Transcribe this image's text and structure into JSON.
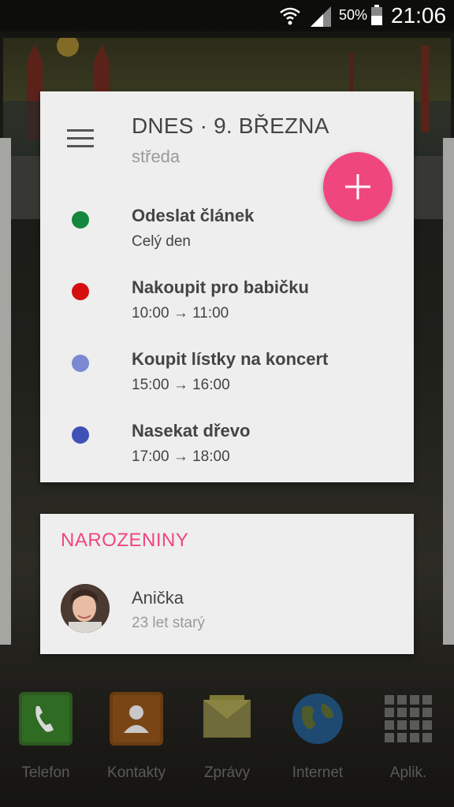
{
  "status_bar": {
    "battery": "50%",
    "time": "21:06"
  },
  "agenda": {
    "date_title": "DNES · 9. BŘEZNA",
    "weekday": "středa",
    "events": [
      {
        "title": "Odeslat článek",
        "time": "Celý den",
        "color": "#14873e"
      },
      {
        "title": "Nakoupit pro babičku",
        "time": "10:00 → 11:00",
        "color": "#d50e0e"
      },
      {
        "title": "Koupit lístky na koncert",
        "time": "15:00 → 16:00",
        "color": "#7b88d2"
      },
      {
        "title": "Nasekat dřevo",
        "time": "17:00 → 18:00",
        "color": "#3f51b5"
      }
    ],
    "fab_icon": "plus-icon",
    "fab_color": "#f0467e"
  },
  "birthdays": {
    "header": "NAROZENINY",
    "people": [
      {
        "name": "Anička",
        "age": "23 let starý"
      }
    ]
  },
  "dock": {
    "items": [
      {
        "label": "Telefon",
        "icon": "phone-icon"
      },
      {
        "label": "Kontakty",
        "icon": "contacts-icon"
      },
      {
        "label": "Zprávy",
        "icon": "messages-icon"
      },
      {
        "label": "Internet",
        "icon": "globe-icon"
      },
      {
        "label": "Aplik.",
        "icon": "apps-grid-icon"
      }
    ]
  }
}
